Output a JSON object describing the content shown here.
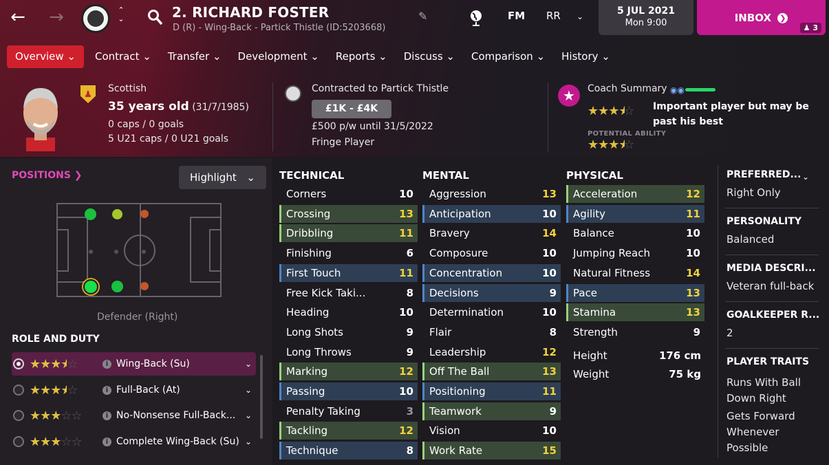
{
  "header": {
    "title": "2. RICHARD FOSTER",
    "subtitle": "D (R) - Wing-Back - Partick Thistle (ID:5203668)",
    "fm_label": "FM",
    "user_initials": "RR",
    "date": "5 JUL 2021",
    "time": "Mon 9:00",
    "inbox_label": "INBOX",
    "inbox_count": "3"
  },
  "tabs": [
    "Overview",
    "Contract",
    "Transfer",
    "Development",
    "Reports",
    "Discuss",
    "Comparison",
    "History"
  ],
  "profile": {
    "nationality": "Scottish",
    "age": "35 years old",
    "dob": "(31/7/1985)",
    "caps": "0 caps / 0 goals",
    "u21_caps": "5 U21 caps / 0 U21 goals"
  },
  "contract": {
    "club_line": "Contracted to Partick Thistle",
    "value_range": "£1K - £4K",
    "wage": "£500 p/w until 31/5/2022",
    "status": "Fringe Player"
  },
  "coach": {
    "title": "Coach Summary",
    "current_stars": 3.5,
    "summary": "Important player but may be past his best",
    "pa_label": "POTENTIAL ABILITY",
    "potential_stars": 3.5
  },
  "positions": {
    "link": "POSITIONS",
    "highlight_label": "Highlight",
    "position_label": "Defender (Right)"
  },
  "roles": {
    "heading": "ROLE AND DUTY",
    "items": [
      {
        "name": "Wing-Back (Su)",
        "stars": 3.5
      },
      {
        "name": "Full-Back (At)",
        "stars": 3.5
      },
      {
        "name": "No-Nonsense Full-Back...",
        "stars": 3
      },
      {
        "name": "Complete Wing-Back (Su)",
        "stars": 3
      }
    ]
  },
  "technical": {
    "heading": "TECHNICAL",
    "items": [
      {
        "name": "Corners",
        "value": "10",
        "hl": ""
      },
      {
        "name": "Crossing",
        "value": "13",
        "hl": "g"
      },
      {
        "name": "Dribbling",
        "value": "11",
        "hl": "g"
      },
      {
        "name": "Finishing",
        "value": "6",
        "hl": ""
      },
      {
        "name": "First Touch",
        "value": "11",
        "hl": "b"
      },
      {
        "name": "Free Kick Taki...",
        "value": "8",
        "hl": ""
      },
      {
        "name": "Heading",
        "value": "10",
        "hl": ""
      },
      {
        "name": "Long Shots",
        "value": "9",
        "hl": ""
      },
      {
        "name": "Long Throws",
        "value": "9",
        "hl": ""
      },
      {
        "name": "Marking",
        "value": "12",
        "hl": "g"
      },
      {
        "name": "Passing",
        "value": "10",
        "hl": "b"
      },
      {
        "name": "Penalty Taking",
        "value": "3",
        "hl": ""
      },
      {
        "name": "Tackling",
        "value": "12",
        "hl": "g"
      },
      {
        "name": "Technique",
        "value": "8",
        "hl": "b"
      }
    ]
  },
  "mental": {
    "heading": "MENTAL",
    "items": [
      {
        "name": "Aggression",
        "value": "13",
        "hl": ""
      },
      {
        "name": "Anticipation",
        "value": "10",
        "hl": "b"
      },
      {
        "name": "Bravery",
        "value": "14",
        "hl": ""
      },
      {
        "name": "Composure",
        "value": "10",
        "hl": ""
      },
      {
        "name": "Concentration",
        "value": "10",
        "hl": "b"
      },
      {
        "name": "Decisions",
        "value": "9",
        "hl": "b"
      },
      {
        "name": "Determination",
        "value": "10",
        "hl": ""
      },
      {
        "name": "Flair",
        "value": "8",
        "hl": ""
      },
      {
        "name": "Leadership",
        "value": "12",
        "hl": ""
      },
      {
        "name": "Off The Ball",
        "value": "13",
        "hl": "g"
      },
      {
        "name": "Positioning",
        "value": "11",
        "hl": "b"
      },
      {
        "name": "Teamwork",
        "value": "9",
        "hl": "g"
      },
      {
        "name": "Vision",
        "value": "10",
        "hl": ""
      },
      {
        "name": "Work Rate",
        "value": "15",
        "hl": "g"
      }
    ]
  },
  "physical": {
    "heading": "PHYSICAL",
    "items": [
      {
        "name": "Acceleration",
        "value": "12",
        "hl": "g"
      },
      {
        "name": "Agility",
        "value": "11",
        "hl": "b"
      },
      {
        "name": "Balance",
        "value": "10",
        "hl": ""
      },
      {
        "name": "Jumping Reach",
        "value": "10",
        "hl": ""
      },
      {
        "name": "Natural Fitness",
        "value": "14",
        "hl": ""
      },
      {
        "name": "Pace",
        "value": "13",
        "hl": "b"
      },
      {
        "name": "Stamina",
        "value": "13",
        "hl": "g"
      },
      {
        "name": "Strength",
        "value": "9",
        "hl": ""
      }
    ],
    "height_label": "Height",
    "height": "176 cm",
    "weight_label": "Weight",
    "weight": "75 kg"
  },
  "side": {
    "preferred_foot_head": "PREFERRED...",
    "preferred_foot": "Right Only",
    "personality_head": "PERSONALITY",
    "personality": "Balanced",
    "media_head": "MEDIA DESCRI...",
    "media": "Veteran full-back",
    "gk_head": "GOALKEEPER R...",
    "gk": "2",
    "traits_head": "PLAYER TRAITS",
    "trait1a": "Runs With Ball",
    "trait1b": "Down Right",
    "trait2a": "Gets Forward",
    "trait2b": "Whenever",
    "trait2c": "Possible"
  },
  "colors": {
    "accent": "#d0202e",
    "inbox": "#c2198f",
    "highlight_good": "#9ad17a",
    "highlight_key": "#4f86c4"
  }
}
